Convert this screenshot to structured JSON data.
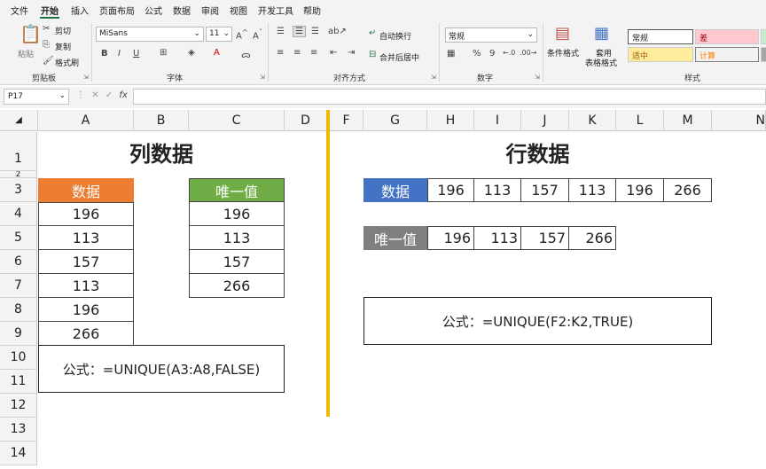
{
  "menu": [
    "文件",
    "开始",
    "插入",
    "页面布局",
    "公式",
    "数据",
    "审阅",
    "视图",
    "开发工具",
    "帮助"
  ],
  "ribbon": {
    "clipboard": {
      "paste": "粘贴",
      "cut": "剪切",
      "copy": "复制",
      "format_painter": "格式刷",
      "label": "剪贴板"
    },
    "font": {
      "name": "MiSans",
      "size": "11",
      "label": "字体"
    },
    "alignment": {
      "wrap": "自动换行",
      "merge": "合并后居中",
      "label": "对齐方式"
    },
    "number": {
      "format": "常规",
      "label": "数字"
    },
    "styles": {
      "conditional": "条件格式",
      "table_format_1": "套用",
      "table_format_2": "表格格式",
      "normal": "常规",
      "bad": "差",
      "neutral": "适中",
      "calc": "计算",
      "label": "样式"
    }
  },
  "formula_bar": {
    "name_box": "P17",
    "fx": "fx"
  },
  "columns": [
    "A",
    "B",
    "C",
    "D",
    "F",
    "G",
    "H",
    "I",
    "J",
    "K",
    "L",
    "M",
    "N"
  ],
  "rows": [
    "1",
    "2",
    "3",
    "4",
    "5",
    "6",
    "7",
    "8",
    "9",
    "10",
    "11",
    "12",
    "13",
    "14"
  ],
  "left": {
    "title": "列数据",
    "data_header": "数据",
    "data_values": [
      "196",
      "113",
      "157",
      "113",
      "196",
      "266"
    ],
    "unique_header": "唯一值",
    "unique_values": [
      "196",
      "113",
      "157",
      "266"
    ],
    "formula": "公式：=UNIQUE(A3:A8,FALSE)"
  },
  "right": {
    "title": "行数据",
    "data_header": "数据",
    "data_values": [
      "196",
      "113",
      "157",
      "113",
      "196",
      "266"
    ],
    "unique_header": "唯一值",
    "unique_values": [
      "196",
      "113",
      "157",
      "266"
    ],
    "formula": "公式：=UNIQUE(F2:K2,TRUE)"
  },
  "colors": {
    "orange": "#ed7d31",
    "green": "#70ad47",
    "blue": "#4472c4",
    "gray": "#7f7f7f",
    "divider": "#f2b705"
  }
}
